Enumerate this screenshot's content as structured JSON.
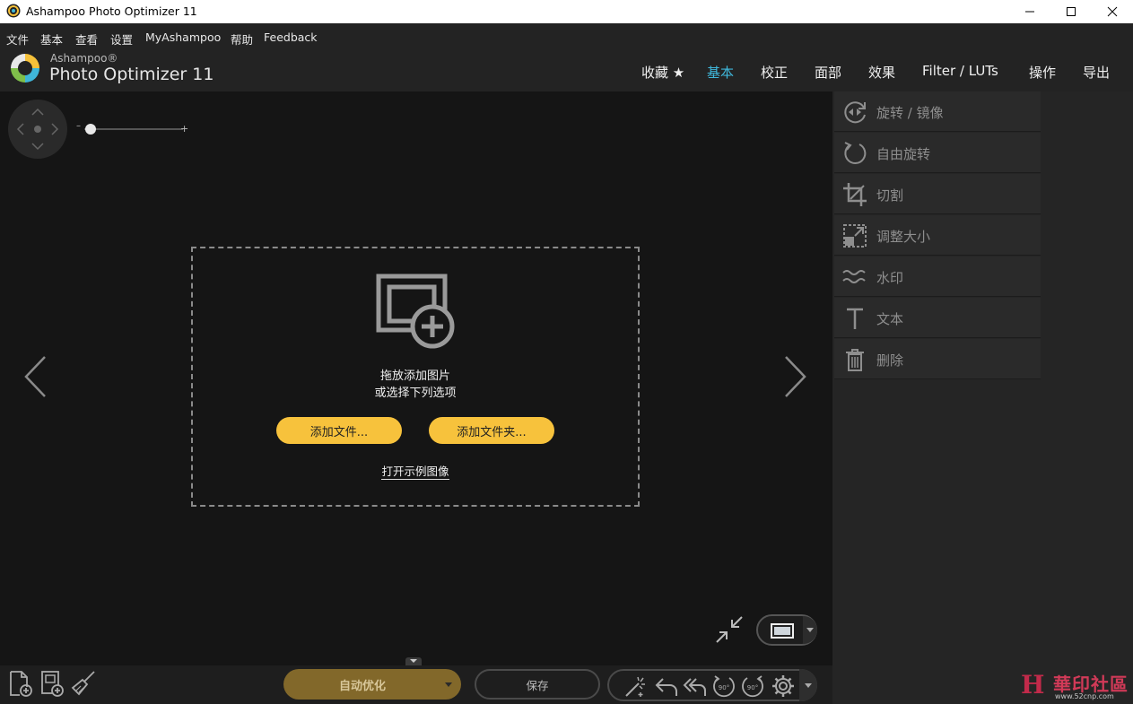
{
  "window": {
    "title": "Ashampoo Photo Optimizer 11"
  },
  "menu": [
    "文件",
    "基本",
    "查看",
    "设置",
    "MyAshampoo",
    "帮助",
    "Feedback"
  ],
  "brand": {
    "small": "Ashampoo®",
    "large": "Photo Optimizer 11"
  },
  "tabs": [
    {
      "label": "收藏 ★",
      "active": false
    },
    {
      "label": "基本",
      "active": true
    },
    {
      "label": "校正",
      "active": false
    },
    {
      "label": "面部",
      "active": false
    },
    {
      "label": "效果",
      "active": false
    },
    {
      "label": "Filter / LUTs",
      "active": false
    },
    {
      "label": "操作",
      "active": false
    },
    {
      "label": "导出",
      "active": false
    }
  ],
  "zoom": {
    "minus": "–",
    "plus": "+",
    "level": 0.05
  },
  "dropzone": {
    "line1": "拖放添加图片",
    "line2": "或选择下列选项",
    "add_files": "添加文件...",
    "add_folder": "添加文件夹...",
    "sample_link": "打开示例图像"
  },
  "tools": [
    {
      "label": "旋转 / 镜像",
      "icon": "rotate-mirror-icon"
    },
    {
      "label": "自由旋转",
      "icon": "free-rotate-icon"
    },
    {
      "label": "切割",
      "icon": "crop-icon"
    },
    {
      "label": "调整大小",
      "icon": "resize-icon"
    },
    {
      "label": "水印",
      "icon": "watermark-icon"
    },
    {
      "label": "文本",
      "icon": "text-icon"
    },
    {
      "label": "删除",
      "icon": "delete-icon"
    }
  ],
  "bottom": {
    "auto_optimize": "自动优化",
    "save": "保存",
    "rotate_label": "90°"
  },
  "watermark": {
    "mark": "H",
    "text": "華印社區",
    "url": "www.52cnp.com"
  },
  "colors": {
    "accent": "#3fb6d9",
    "button_yellow": "#f7c23c",
    "auto_optimize": "#82682a",
    "background": "#151515",
    "panel": "#252525"
  }
}
